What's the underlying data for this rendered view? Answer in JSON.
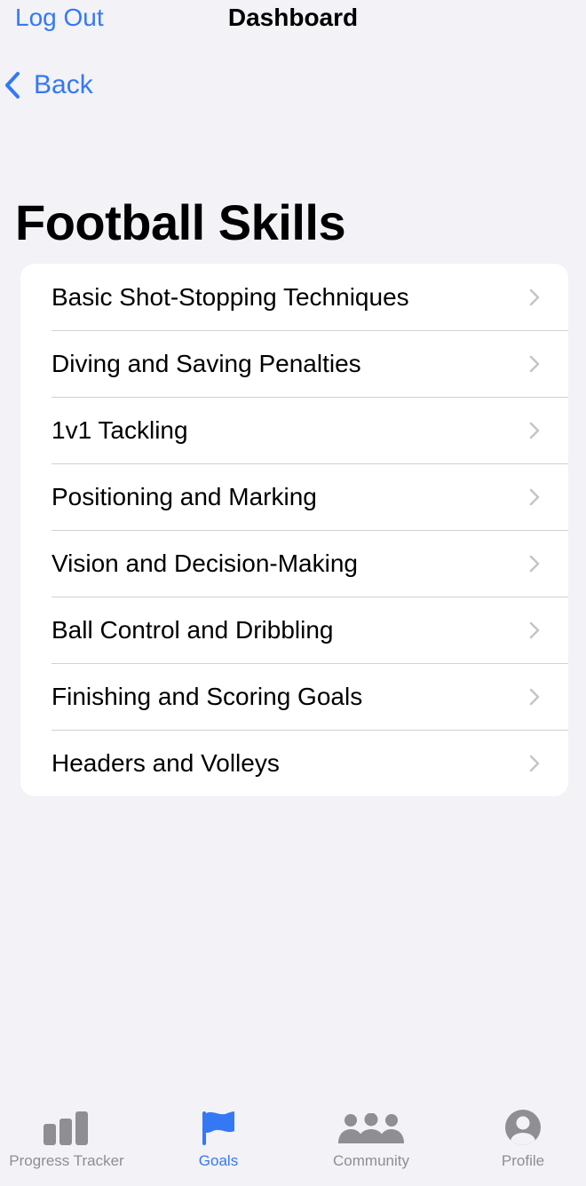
{
  "header": {
    "logout_label": "Log Out",
    "title": "Dashboard"
  },
  "back": {
    "label": "Back",
    "icon": "chevron-left-icon"
  },
  "page": {
    "title": "Football Skills"
  },
  "skills": [
    {
      "label": "Basic Shot-Stopping Techniques"
    },
    {
      "label": "Diving and Saving Penalties"
    },
    {
      "label": "1v1 Tackling"
    },
    {
      "label": "Positioning and Marking"
    },
    {
      "label": "Vision and Decision-Making"
    },
    {
      "label": "Ball Control and Dribbling"
    },
    {
      "label": "Finishing and Scoring Goals"
    },
    {
      "label": "Headers and Volleys"
    }
  ],
  "tabs": [
    {
      "label": "Progress Tracker",
      "icon": "bar-chart-icon",
      "active": false
    },
    {
      "label": "Goals",
      "icon": "flag-icon",
      "active": true
    },
    {
      "label": "Community",
      "icon": "people-icon",
      "active": false
    },
    {
      "label": "Profile",
      "icon": "person-circle-icon",
      "active": false
    }
  ],
  "colors": {
    "accent": "#3478f6",
    "inactive": "#8e8e93",
    "background": "#f2f2f7"
  }
}
